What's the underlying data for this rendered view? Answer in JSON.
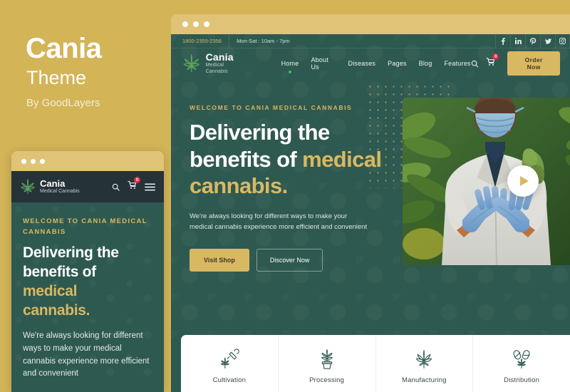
{
  "promo": {
    "title": "Cania",
    "subtitle": "Theme",
    "author": "By GoodLayers"
  },
  "browser": {
    "chrome_dots": [
      "dot",
      "dot",
      "dot"
    ]
  },
  "site": {
    "topbar": {
      "phone": "1800-2355-2356",
      "hours": "Mon-Sat : 10am - 7pm",
      "socials": [
        {
          "name": "facebook-icon",
          "glyph": "f"
        },
        {
          "name": "linkedin-icon",
          "glyph": "in"
        },
        {
          "name": "pinterest-icon",
          "glyph": "P"
        },
        {
          "name": "twitter-icon",
          "glyph": "ᵛ"
        },
        {
          "name": "instagram-icon",
          "glyph": "▣"
        }
      ]
    },
    "logo": {
      "name": "Cania",
      "tagline": "Medical Cannabis"
    },
    "menu": [
      {
        "label": "Home",
        "active": true
      },
      {
        "label": "About Us",
        "active": false
      },
      {
        "label": "Diseases",
        "active": false
      },
      {
        "label": "Pages",
        "active": false
      },
      {
        "label": "Blog",
        "active": false
      },
      {
        "label": "Features",
        "active": false
      }
    ],
    "nav_actions": {
      "search_label": "search-icon",
      "cart_label": "cart-icon",
      "cart_count": "0",
      "order_button": "Order Now"
    },
    "hero": {
      "eyebrow": "WELCOME TO CANIA MEDICAL CANNABIS",
      "heading_line1": "Delivering the",
      "heading_line2_white": "benefits of ",
      "heading_line2_gold": "medical",
      "heading_line3_gold": "cannabis.",
      "paragraph": "We're always looking for different ways to make your medical cannabis experience more efficient and convenient",
      "primary_button": "Visit Shop",
      "secondary_button": "Discover Now",
      "media_alt": "scientist-inspecting-cannabis-plant",
      "play_label": "play-video-button"
    },
    "features": [
      {
        "label": "Cultivation",
        "icon": "watering-can-sprout-icon"
      },
      {
        "label": "Processing",
        "icon": "potted-plant-icon"
      },
      {
        "label": "Manufacturing",
        "icon": "cannabis-leaf-icon"
      },
      {
        "label": "Distribution",
        "icon": "capsules-icon"
      }
    ]
  },
  "mobile": {
    "logo": {
      "name": "Cania",
      "tagline": "Medical Cannabis"
    },
    "cart_count": "0",
    "eyebrow": "WELCOME TO CANIA MEDICAL CANNABIS",
    "heading_line1": "Delivering the",
    "heading_line2": "benefits of",
    "heading_line3_gold": "medical",
    "heading_line4_gold": "cannabis.",
    "paragraph": "We're always looking for different ways to make your medical cannabis experience more efficient and convenient"
  },
  "colors": {
    "gold": "#d3b457",
    "accent_gold": "#d9b862",
    "deep_green": "#2e5950",
    "dark_header": "#253238",
    "badge_red": "#e8274b",
    "active_dot_green": "#3fb36c"
  }
}
